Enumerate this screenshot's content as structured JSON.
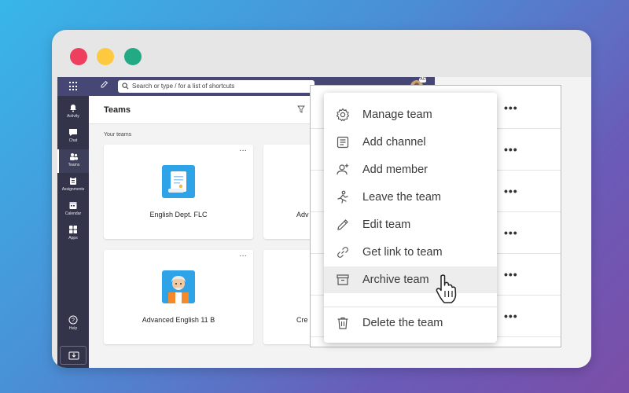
{
  "topbar": {
    "search_placeholder": "Search or type / for a list of shortcuts",
    "avatar_badge": "AO"
  },
  "rail": {
    "items": [
      {
        "label": "Activity",
        "icon": "bell-icon"
      },
      {
        "label": "Chat",
        "icon": "chat-icon"
      },
      {
        "label": "Teams",
        "icon": "teams-icon"
      },
      {
        "label": "Assignments",
        "icon": "assignments-icon"
      },
      {
        "label": "Calendar",
        "icon": "calendar-icon"
      },
      {
        "label": "Apps",
        "icon": "apps-icon"
      }
    ],
    "help_label": "Help"
  },
  "main": {
    "title": "Teams",
    "section_label": "Your teams",
    "cards": [
      {
        "name": "English Dept. FLC"
      },
      {
        "name": "Adv"
      },
      {
        "name": "Advanced English 11 B"
      },
      {
        "name": "Cre"
      }
    ]
  },
  "context_menu": {
    "items": [
      {
        "label": "Manage team",
        "icon": "gear-icon"
      },
      {
        "label": "Add channel",
        "icon": "channel-icon"
      },
      {
        "label": "Add member",
        "icon": "add-member-icon"
      },
      {
        "label": "Leave the team",
        "icon": "leave-icon"
      },
      {
        "label": "Edit team",
        "icon": "pencil-icon"
      },
      {
        "label": "Get link to team",
        "icon": "link-icon"
      },
      {
        "label": "Archive team",
        "icon": "archive-icon"
      },
      {
        "label": "Delete the team",
        "icon": "trash-icon"
      }
    ],
    "hovered": "Archive team"
  },
  "right_panel": {
    "more_label": "•••"
  },
  "colors": {
    "teams_header": "#464775",
    "rail": "#33344a",
    "hover_bg": "#ededed",
    "traffic_red": "#ee3f5e",
    "traffic_yellow": "#fdc93f",
    "traffic_green": "#21aa84"
  }
}
